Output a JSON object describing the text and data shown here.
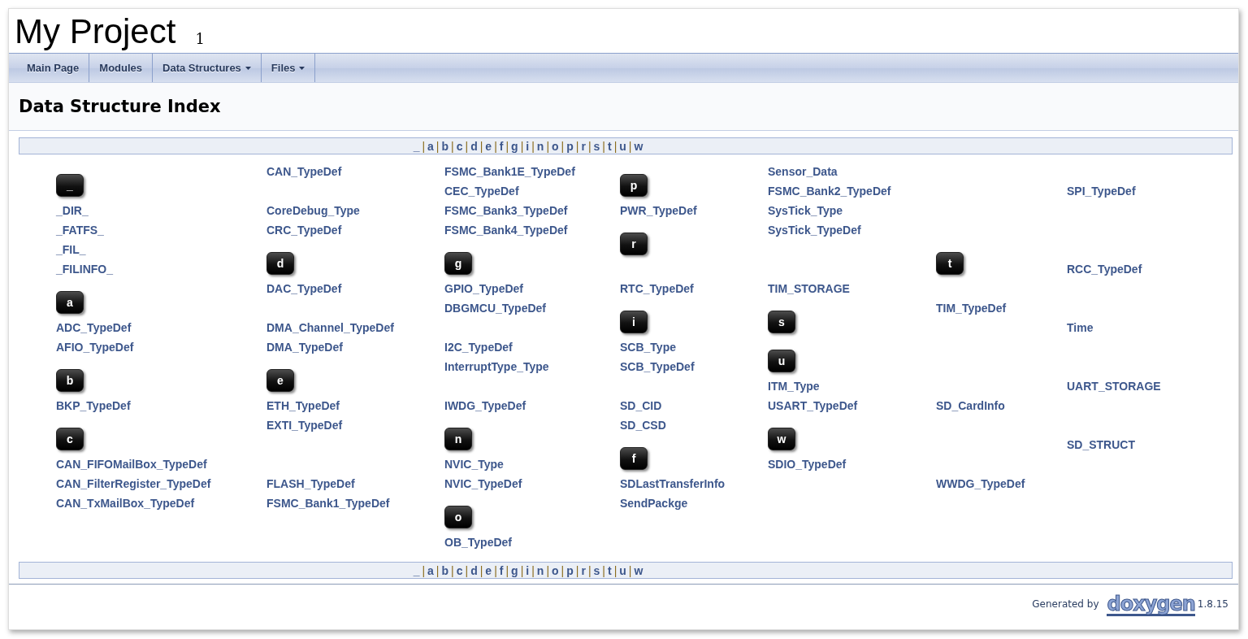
{
  "project": {
    "name": "My Project",
    "number": "1"
  },
  "nav": [
    {
      "label": "Main Page",
      "dropdown": false
    },
    {
      "label": "Modules",
      "dropdown": false
    },
    {
      "label": "Data Structures",
      "dropdown": true
    },
    {
      "label": "Files",
      "dropdown": true
    }
  ],
  "heading": "Data Structure Index",
  "alphabet_top": {
    "letters": [
      "_",
      "a",
      "b",
      "c",
      "d",
      "e",
      "f",
      "g",
      "i",
      "n",
      "o",
      "p",
      "r",
      "s",
      "t",
      "u",
      "w"
    ],
    "separator": "|"
  },
  "columns": [
    [
      {
        "kind": "letter",
        "text": "_"
      },
      {
        "kind": "link",
        "text": "_DIR_"
      },
      {
        "kind": "link",
        "text": "_FATFS_"
      },
      {
        "kind": "link",
        "text": "_FIL_"
      },
      {
        "kind": "link",
        "text": "_FILINFO_"
      },
      {
        "kind": "letter",
        "text": "a"
      },
      {
        "kind": "link",
        "text": "ADC_TypeDef"
      },
      {
        "kind": "link",
        "text": "AFIO_TypeDef"
      },
      {
        "kind": "letter",
        "text": "b"
      },
      {
        "kind": "link",
        "text": "BKP_TypeDef"
      },
      {
        "kind": "letter",
        "text": "c"
      },
      {
        "kind": "link",
        "text": "CAN_FIFOMailBox_TypeDef"
      },
      {
        "kind": "link",
        "text": "CAN_FilterRegister_TypeDef"
      },
      {
        "kind": "link",
        "text": "CAN_TxMailBox_TypeDef"
      }
    ],
    [
      {
        "kind": "link",
        "text": "CAN_TypeDef"
      },
      {
        "kind": "blank"
      },
      {
        "kind": "link",
        "text": "CoreDebug_Type"
      },
      {
        "kind": "link",
        "text": "CRC_TypeDef"
      },
      {
        "kind": "letter",
        "text": "d"
      },
      {
        "kind": "link",
        "text": "DAC_TypeDef"
      },
      {
        "kind": "blank"
      },
      {
        "kind": "link",
        "text": "DMA_Channel_TypeDef"
      },
      {
        "kind": "link",
        "text": "DMA_TypeDef"
      },
      {
        "kind": "letter",
        "text": "e"
      },
      {
        "kind": "link",
        "text": "ETH_TypeDef"
      },
      {
        "kind": "link",
        "text": "EXTI_TypeDef"
      },
      {
        "kind": "blank"
      },
      {
        "kind": "blank"
      },
      {
        "kind": "link",
        "text": "FLASH_TypeDef"
      },
      {
        "kind": "link",
        "text": "FSMC_Bank1_TypeDef"
      }
    ],
    [
      {
        "kind": "link",
        "text": "FSMC_Bank1E_TypeDef"
      },
      {
        "kind": "link",
        "text": "CEC_TypeDef"
      },
      {
        "kind": "link",
        "text": "FSMC_Bank3_TypeDef"
      },
      {
        "kind": "link",
        "text": "FSMC_Bank4_TypeDef"
      },
      {
        "kind": "letter",
        "text": "g"
      },
      {
        "kind": "link",
        "text": "GPIO_TypeDef"
      },
      {
        "kind": "link",
        "text": "DBGMCU_TypeDef"
      },
      {
        "kind": "blank"
      },
      {
        "kind": "link",
        "text": "I2C_TypeDef"
      },
      {
        "kind": "link",
        "text": "InterruptType_Type"
      },
      {
        "kind": "blank"
      },
      {
        "kind": "link",
        "text": "IWDG_TypeDef"
      },
      {
        "kind": "letter",
        "text": "n"
      },
      {
        "kind": "link",
        "text": "NVIC_Type"
      },
      {
        "kind": "link",
        "text": "NVIC_TypeDef"
      },
      {
        "kind": "letter",
        "text": "o"
      },
      {
        "kind": "link",
        "text": "OB_TypeDef"
      }
    ],
    [
      {
        "kind": "letter",
        "text": "p"
      },
      {
        "kind": "link",
        "text": "PWR_TypeDef"
      },
      {
        "kind": "letter",
        "text": "r"
      },
      {
        "kind": "blank"
      },
      {
        "kind": "link",
        "text": "RTC_TypeDef"
      },
      {
        "kind": "letter",
        "text": "i"
      },
      {
        "kind": "link",
        "text": "SCB_Type"
      },
      {
        "kind": "link",
        "text": "SCB_TypeDef"
      },
      {
        "kind": "blank"
      },
      {
        "kind": "link",
        "text": "SD_CID"
      },
      {
        "kind": "link",
        "text": "SD_CSD"
      },
      {
        "kind": "letter",
        "text": "f"
      },
      {
        "kind": "link",
        "text": "SDLastTransferInfo"
      },
      {
        "kind": "link",
        "text": "SendPackge"
      }
    ],
    [
      {
        "kind": "link",
        "text": "Sensor_Data"
      },
      {
        "kind": "link",
        "text": "FSMC_Bank2_TypeDef"
      },
      {
        "kind": "link",
        "text": "SysTick_Type"
      },
      {
        "kind": "link",
        "text": "SysTick_TypeDef"
      },
      {
        "kind": "blank"
      },
      {
        "kind": "blank"
      },
      {
        "kind": "link",
        "text": "TIM_STORAGE"
      },
      {
        "kind": "letter",
        "text": "s"
      },
      {
        "kind": "letter",
        "text": "u"
      },
      {
        "kind": "link",
        "text": "ITM_Type"
      },
      {
        "kind": "link",
        "text": "USART_TypeDef"
      },
      {
        "kind": "letter",
        "text": "w"
      },
      {
        "kind": "link",
        "text": "SDIO_TypeDef"
      }
    ],
    [
      {
        "kind": "blank"
      },
      {
        "kind": "blank"
      },
      {
        "kind": "blank"
      },
      {
        "kind": "blank"
      },
      {
        "kind": "letter",
        "text": "t"
      },
      {
        "kind": "blank"
      },
      {
        "kind": "link",
        "text": "TIM_TypeDef"
      },
      {
        "kind": "blank"
      },
      {
        "kind": "blank"
      },
      {
        "kind": "blank"
      },
      {
        "kind": "blank"
      },
      {
        "kind": "link",
        "text": "SD_CardInfo"
      },
      {
        "kind": "blank"
      },
      {
        "kind": "blank"
      },
      {
        "kind": "blank"
      },
      {
        "kind": "link",
        "text": "WWDG_TypeDef"
      }
    ],
    [
      {
        "kind": "blank"
      },
      {
        "kind": "link",
        "text": "SPI_TypeDef"
      },
      {
        "kind": "blank"
      },
      {
        "kind": "blank"
      },
      {
        "kind": "blank"
      },
      {
        "kind": "link",
        "text": "RCC_TypeDef"
      },
      {
        "kind": "blank"
      },
      {
        "kind": "blank"
      },
      {
        "kind": "link",
        "text": "Time"
      },
      {
        "kind": "blank"
      },
      {
        "kind": "blank"
      },
      {
        "kind": "link",
        "text": "UART_STORAGE"
      },
      {
        "kind": "blank"
      },
      {
        "kind": "blank"
      },
      {
        "kind": "link",
        "text": "SD_STRUCT"
      }
    ]
  ],
  "alphabet_bottom": {
    "letters": [
      "_",
      "a",
      "b",
      "c",
      "d",
      "e",
      "f",
      "g",
      "i",
      "n",
      "o",
      "p",
      "r",
      "s",
      "t",
      "u",
      "w"
    ],
    "separator": "|"
  },
  "footer": {
    "generated_by": "Generated by",
    "logo": "doxygen",
    "version": "1.8.15"
  }
}
